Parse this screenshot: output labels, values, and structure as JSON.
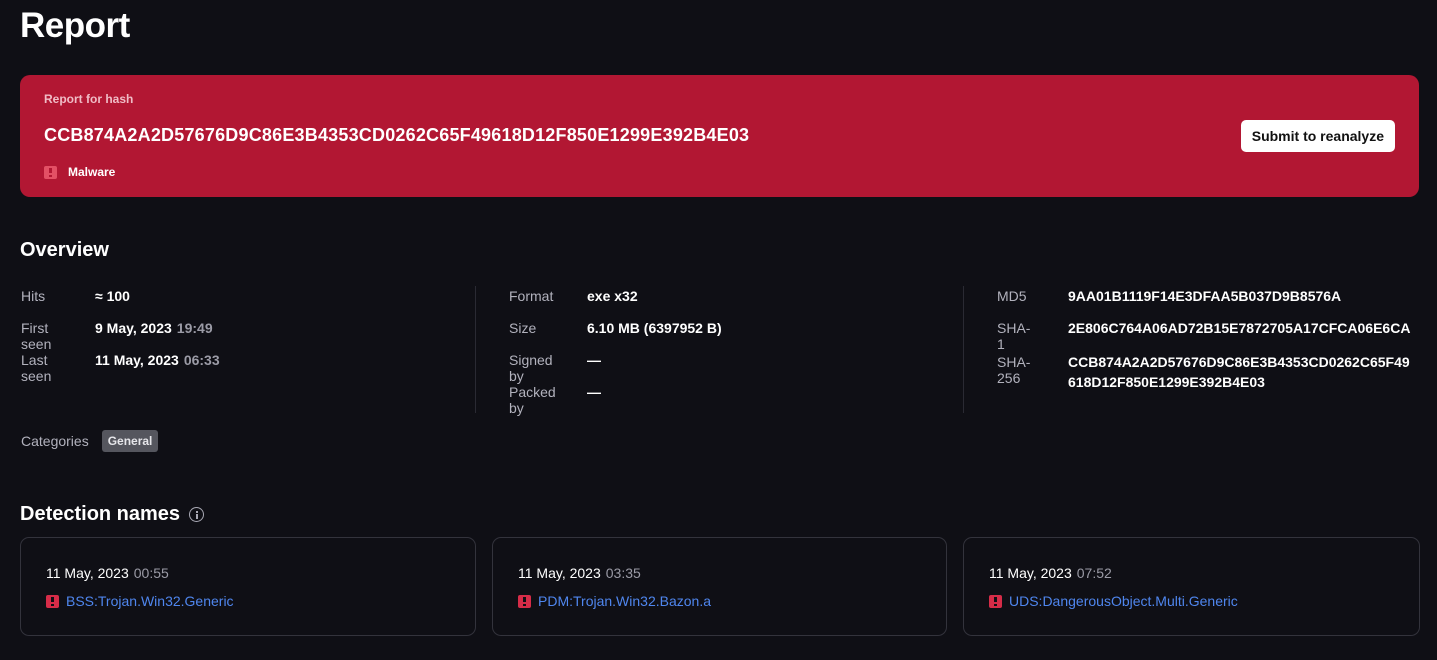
{
  "page_title": "Report",
  "banner": {
    "caption": "Report for hash",
    "hash": "CCB874A2A2D57676D9C86E3B4353CD0262C65F49618D12F850E1299E392B4E03",
    "verdict": "Malware",
    "reanalyze_label": "Submit to reanalyze",
    "color": "#b21733"
  },
  "overview": {
    "title": "Overview",
    "col1": {
      "hits_label": "Hits",
      "hits_value": "≈ 100",
      "first_seen_label": "First seen",
      "first_seen_date": "9 May, 2023",
      "first_seen_time": "19:49",
      "last_seen_label": "Last seen",
      "last_seen_date": "11 May, 2023",
      "last_seen_time": "06:33"
    },
    "col2": {
      "format_label": "Format",
      "format_value": "exe x32",
      "size_label": "Size",
      "size_value": "6.10 MB (6397952 B)",
      "signed_label": "Signed by",
      "signed_value": "—",
      "packed_label": "Packed by",
      "packed_value": "—"
    },
    "col3": {
      "md5_label": "MD5",
      "md5_value": "9AA01B1119F14E3DFAA5B037D9B8576A",
      "sha1_label": "SHA-1",
      "sha1_value": "2E806C764A06AD72B15E7872705A17CFCA06E6CA",
      "sha256_label": "SHA-256",
      "sha256_value": "CCB874A2A2D57676D9C86E3B4353CD0262C65F49618D12F850E1299E392B4E03"
    },
    "categories_label": "Categories",
    "category": "General"
  },
  "detections": {
    "title": "Detection names",
    "items": [
      {
        "date": "11 May, 2023",
        "time": "00:55",
        "name": "BSS:Trojan.Win32.Generic"
      },
      {
        "date": "11 May, 2023",
        "time": "03:35",
        "name": "PDM:Trojan.Win32.Bazon.a"
      },
      {
        "date": "11 May, 2023",
        "time": "07:52",
        "name": "UDS:DangerousObject.Multi.Generic"
      }
    ]
  },
  "icons": {
    "alert": "alert-icon",
    "info": "info-icon"
  },
  "colors": {
    "background": "#0f0f15",
    "danger": "#b21733",
    "link": "#4f86ee"
  }
}
